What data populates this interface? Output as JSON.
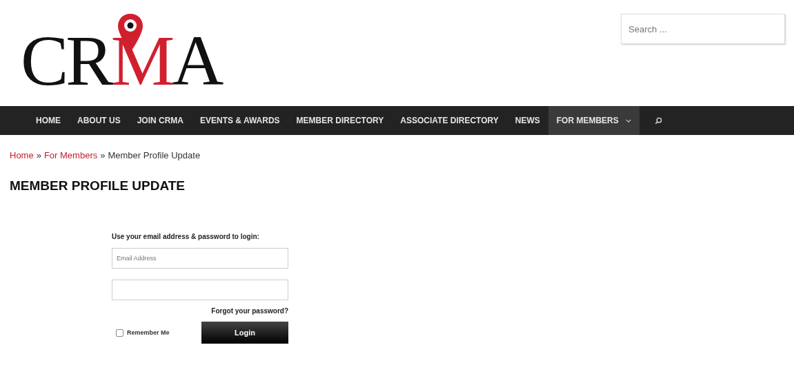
{
  "logo": {
    "parts": [
      {
        "text": "CR",
        "accent": false
      },
      {
        "text": "M",
        "accent": true
      },
      {
        "text": "A",
        "accent": false
      }
    ]
  },
  "search": {
    "placeholder": "Search ..."
  },
  "nav": {
    "items": [
      {
        "label": "HOME",
        "selected": false,
        "dropdown": false
      },
      {
        "label": "ABOUT US",
        "selected": false,
        "dropdown": false
      },
      {
        "label": "JOIN CRMA",
        "selected": false,
        "dropdown": false
      },
      {
        "label": "EVENTS & AWARDS",
        "selected": false,
        "dropdown": false
      },
      {
        "label": "MEMBER DIRECTORY",
        "selected": false,
        "dropdown": false
      },
      {
        "label": "ASSOCIATE DIRECTORY",
        "selected": false,
        "dropdown": false
      },
      {
        "label": "NEWS",
        "selected": false,
        "dropdown": false
      },
      {
        "label": "FOR MEMBERS",
        "selected": true,
        "dropdown": true
      }
    ]
  },
  "breadcrumb": [
    {
      "text": "Home",
      "kind": "link"
    },
    {
      "text": "»",
      "kind": "separator"
    },
    {
      "text": "For Members",
      "kind": "link"
    },
    {
      "text": "»",
      "kind": "separator"
    },
    {
      "text": "Member Profile Update",
      "kind": "current"
    }
  ],
  "page_title": "MEMBER PROFILE UPDATE",
  "login": {
    "prompt": "Use your email address & password to login:",
    "email_placeholder": "Email Address",
    "forgot_link": "Forgot your password?",
    "remember_label": "Remember Me",
    "remember_checked": false,
    "button": "Login"
  }
}
